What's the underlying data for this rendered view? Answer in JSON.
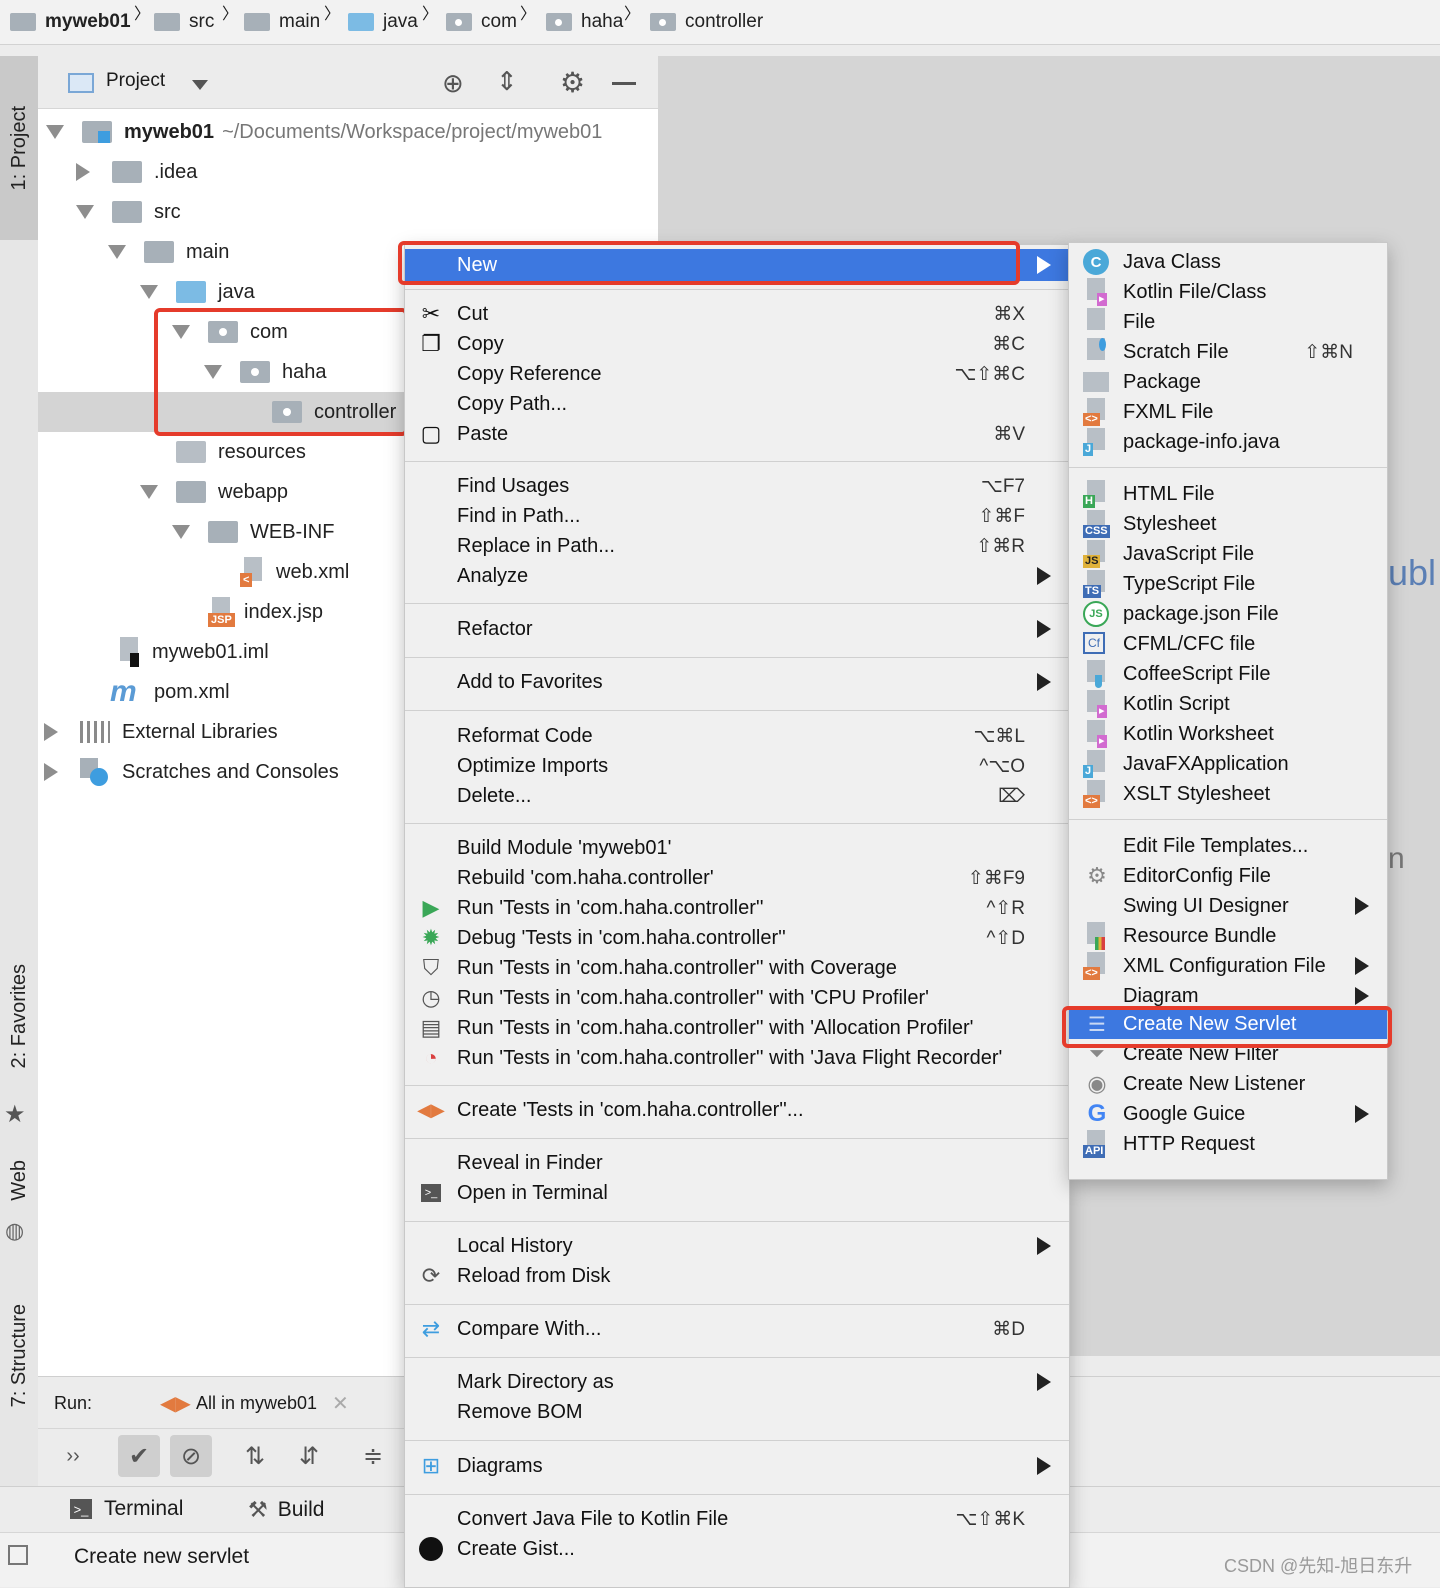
{
  "breadcrumb": [
    "myweb01",
    "src",
    "main",
    "java",
    "com",
    "haha",
    "controller"
  ],
  "left_tabs": {
    "project": "1: Project",
    "favorites": "2: Favorites",
    "web": "Web",
    "structure": "7: Structure"
  },
  "project_panel": {
    "title": "Project",
    "root_name": "myweb01",
    "root_path": "~/Documents/Workspace/project/myweb01",
    "tree": [
      {
        "label": ".idea"
      },
      {
        "label": "src"
      },
      {
        "label": "main"
      },
      {
        "label": "java"
      },
      {
        "label": "com"
      },
      {
        "label": "haha"
      },
      {
        "label": "controller"
      },
      {
        "label": "resources"
      },
      {
        "label": "webapp"
      },
      {
        "label": "WEB-INF"
      },
      {
        "label": "web.xml"
      },
      {
        "label": "index.jsp"
      },
      {
        "label": "myweb01.iml"
      },
      {
        "label": "pom.xml"
      },
      {
        "label": "External Libraries"
      },
      {
        "label": "Scratches and Consoles"
      }
    ],
    "jsp_tag": "JSP"
  },
  "editor_fragments": [
    "ubl",
    "n"
  ],
  "run_panel": {
    "label": "Run:",
    "config": "All in myweb01"
  },
  "bottom_tabs": {
    "terminal": "Terminal",
    "build": "Build"
  },
  "status": {
    "message": "Create new servlet"
  },
  "context_menu": {
    "new": "New",
    "cut": {
      "label": "Cut",
      "shortcut": "⌘X"
    },
    "copy": {
      "label": "Copy",
      "shortcut": "⌘C"
    },
    "copy_reference": {
      "label": "Copy Reference",
      "shortcut": "⌥⇧⌘C"
    },
    "copy_path": {
      "label": "Copy Path..."
    },
    "paste": {
      "label": "Paste",
      "shortcut": "⌘V"
    },
    "find_usages": {
      "label": "Find Usages",
      "shortcut": "⌥F7"
    },
    "find_in_path": {
      "label": "Find in Path...",
      "shortcut": "⇧⌘F"
    },
    "replace_in_path": {
      "label": "Replace in Path...",
      "shortcut": "⇧⌘R"
    },
    "analyze": {
      "label": "Analyze"
    },
    "refactor": {
      "label": "Refactor"
    },
    "add_to_favorites": {
      "label": "Add to Favorites"
    },
    "reformat_code": {
      "label": "Reformat Code",
      "shortcut": "⌥⌘L"
    },
    "optimize_imports": {
      "label": "Optimize Imports",
      "shortcut": "^⌥O"
    },
    "delete": {
      "label": "Delete...",
      "shortcut": "⌦"
    },
    "build_module": {
      "label": "Build Module 'myweb01'"
    },
    "rebuild": {
      "label": "Rebuild 'com.haha.controller'",
      "shortcut": "⇧⌘F9"
    },
    "run_tests": {
      "label": "Run 'Tests in 'com.haha.controller''",
      "shortcut": "^⇧R"
    },
    "debug_tests": {
      "label": "Debug 'Tests in 'com.haha.controller''",
      "shortcut": "^⇧D"
    },
    "run_coverage": {
      "label": "Run 'Tests in 'com.haha.controller'' with Coverage"
    },
    "run_cpu": {
      "label": "Run 'Tests in 'com.haha.controller'' with 'CPU Profiler'"
    },
    "run_alloc": {
      "label": "Run 'Tests in 'com.haha.controller'' with 'Allocation Profiler'"
    },
    "run_jfr": {
      "label": "Run 'Tests in 'com.haha.controller'' with 'Java Flight Recorder'"
    },
    "create_tests": {
      "label": "Create 'Tests in 'com.haha.controller''..."
    },
    "reveal_finder": {
      "label": "Reveal in Finder"
    },
    "open_terminal": {
      "label": "Open in Terminal"
    },
    "local_history": {
      "label": "Local History"
    },
    "reload_disk": {
      "label": "Reload from Disk"
    },
    "compare_with": {
      "label": "Compare With...",
      "shortcut": "⌘D"
    },
    "mark_directory": {
      "label": "Mark Directory as"
    },
    "remove_bom": {
      "label": "Remove BOM"
    },
    "diagrams": {
      "label": "Diagrams"
    },
    "convert_kotlin": {
      "label": "Convert Java File to Kotlin File",
      "shortcut": "⌥⇧⌘K"
    },
    "create_gist": {
      "label": "Create Gist..."
    }
  },
  "submenu": {
    "java_class": "Java Class",
    "kotlin_file": "Kotlin File/Class",
    "file": "File",
    "scratch_file": {
      "label": "Scratch File",
      "shortcut": "⇧⌘N"
    },
    "package": "Package",
    "fxml_file": "FXML File",
    "package_info": "package-info.java",
    "html_file": "HTML File",
    "stylesheet": "Stylesheet",
    "javascript_file": "JavaScript File",
    "typescript_file": "TypeScript File",
    "package_json": "package.json File",
    "cfml_file": "CFML/CFC file",
    "coffeescript_file": "CoffeeScript File",
    "kotlin_script": "Kotlin Script",
    "kotlin_worksheet": "Kotlin Worksheet",
    "javafx_app": "JavaFXApplication",
    "xslt_stylesheet": "XSLT Stylesheet",
    "edit_templates": "Edit File Templates...",
    "editorconfig": "EditorConfig File",
    "swing_designer": "Swing UI Designer",
    "resource_bundle": "Resource Bundle",
    "xml_config": "XML Configuration File",
    "diagram": "Diagram",
    "create_servlet": "Create New Servlet",
    "create_filter": "Create New Filter",
    "create_listener": "Create New Listener",
    "google_guice": "Google Guice",
    "http_request": "HTTP Request",
    "icon_tags": {
      "class": "C",
      "css": "CSS",
      "js": "JS",
      "ts": "TS",
      "html": "H",
      "java": "J",
      "cf": "Cf",
      "api": "API",
      "xml": "<>"
    }
  },
  "watermark": "CSDN @先知-旭日东升",
  "colors": {
    "selection": "#3d78e0",
    "highlight_box": "#e53b2b",
    "folder": "#a7b0b8",
    "source_folder": "#7cbbe4"
  }
}
